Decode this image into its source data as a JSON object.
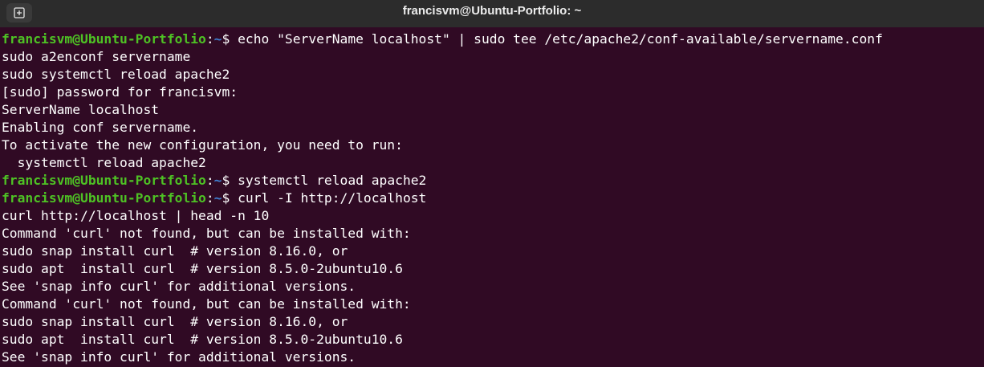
{
  "window": {
    "title": "francisvm@Ubuntu-Portfolio: ~",
    "new_tab_icon": "new-tab-icon"
  },
  "colors": {
    "background": "#300a24",
    "prompt_user": "#4ec224",
    "prompt_path": "#3f7fd0",
    "text": "#ffffff"
  },
  "terminal": {
    "lines": [
      {
        "type": "prompt",
        "user": "francisvm@Ubuntu-Portfolio",
        "sep": ":",
        "path": "~",
        "symbol": "$ ",
        "command": "echo \"ServerName localhost\" | sudo tee /etc/apache2/conf-available/servername.conf"
      },
      {
        "type": "output",
        "text": "sudo a2enconf servername"
      },
      {
        "type": "output",
        "text": "sudo systemctl reload apache2"
      },
      {
        "type": "output",
        "text": "[sudo] password for francisvm:"
      },
      {
        "type": "output",
        "text": "ServerName localhost"
      },
      {
        "type": "output",
        "text": "Enabling conf servername."
      },
      {
        "type": "output",
        "text": "To activate the new configuration, you need to run:"
      },
      {
        "type": "output",
        "text": "  systemctl reload apache2"
      },
      {
        "type": "prompt",
        "user": "francisvm@Ubuntu-Portfolio",
        "sep": ":",
        "path": "~",
        "symbol": "$ ",
        "command": "systemctl reload apache2"
      },
      {
        "type": "prompt",
        "user": "francisvm@Ubuntu-Portfolio",
        "sep": ":",
        "path": "~",
        "symbol": "$ ",
        "command": "curl -I http://localhost"
      },
      {
        "type": "output",
        "text": "curl http://localhost | head -n 10"
      },
      {
        "type": "output",
        "text": "Command 'curl' not found, but can be installed with:"
      },
      {
        "type": "output",
        "text": "sudo snap install curl  # version 8.16.0, or"
      },
      {
        "type": "output",
        "text": "sudo apt  install curl  # version 8.5.0-2ubuntu10.6"
      },
      {
        "type": "output",
        "text": "See 'snap info curl' for additional versions."
      },
      {
        "type": "output",
        "text": "Command 'curl' not found, but can be installed with:"
      },
      {
        "type": "output",
        "text": "sudo snap install curl  # version 8.16.0, or"
      },
      {
        "type": "output",
        "text": "sudo apt  install curl  # version 8.5.0-2ubuntu10.6"
      },
      {
        "type": "output",
        "text": "See 'snap info curl' for additional versions."
      }
    ]
  }
}
